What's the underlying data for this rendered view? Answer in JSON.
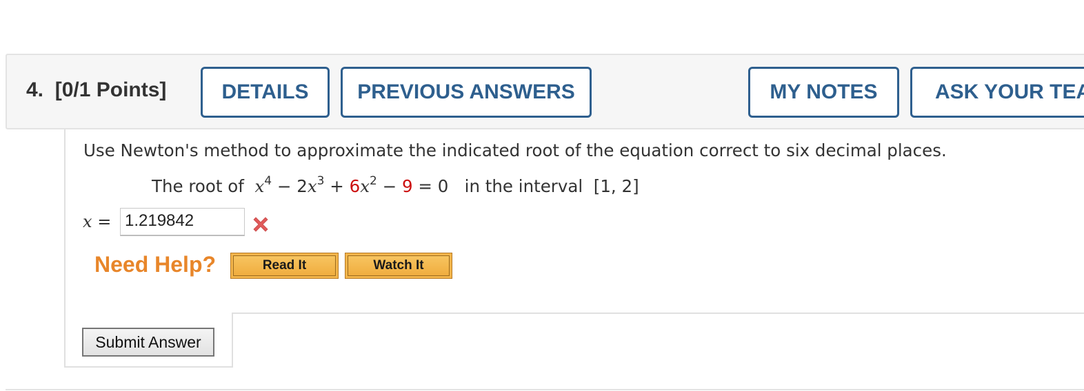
{
  "question": {
    "number_label": "4.",
    "points_label": "[0/1 Points]"
  },
  "header_buttons": {
    "details": "DETAILS",
    "previous_answers": "PREVIOUS ANSWERS",
    "my_notes": "MY NOTES",
    "ask_teacher": "ASK YOUR TEACHER"
  },
  "problem": {
    "prompt": "Use Newton's method to approximate the indicated root of the equation correct to six decimal places.",
    "equation_prefix": "The root of",
    "equation": {
      "term1_var": "x",
      "term1_exp": "4",
      "op1": "−",
      "term2_coef": "2",
      "term2_var": "x",
      "term2_exp": "3",
      "op2": "+",
      "term3_coef": "6",
      "term3_var": "x",
      "term3_exp": "2",
      "op3": "−",
      "constant": "9",
      "equals": "= 0"
    },
    "interval_prefix": "in the interval",
    "interval": "[1, 2]",
    "highlight_color": "#cc1111"
  },
  "answer": {
    "variable": "x",
    "equals": "=",
    "value": "1.219842",
    "status": "incorrect",
    "status_icon": "x-mark-icon",
    "status_color": "#e05a5a"
  },
  "help": {
    "label": "Need Help?",
    "read_it": "Read It",
    "watch_it": "Watch It",
    "label_color": "#e8862a"
  },
  "submit": {
    "label": "Submit Answer"
  },
  "colors": {
    "header_button": "#2e5f8e",
    "header_bg": "#f6f6f6"
  }
}
